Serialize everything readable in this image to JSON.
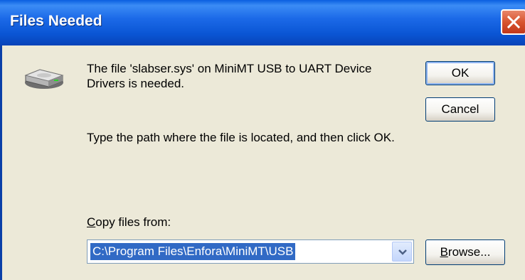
{
  "window": {
    "title": "Files Needed"
  },
  "message": {
    "line1": "The file 'slabser.sys' on MiniMT USB to UART Device Drivers is needed.",
    "line2": "Type the path where the file is located, and then click OK."
  },
  "copy_from": {
    "label_accel": "C",
    "label_rest": "opy files from:",
    "value": "C:\\Program Files\\Enfora\\MiniMT\\USB"
  },
  "buttons": {
    "ok": "OK",
    "cancel": "Cancel",
    "browse_accel": "B",
    "browse_rest": "rowse..."
  },
  "icons": {
    "close": "close-icon",
    "disk": "disk-drive-icon",
    "dropdown": "chevron-down-icon"
  },
  "colors": {
    "titlebar": "#0a55d4",
    "close_button": "#d8542f",
    "dialog_background": "#ece9d8",
    "selection": "#316ac5"
  }
}
